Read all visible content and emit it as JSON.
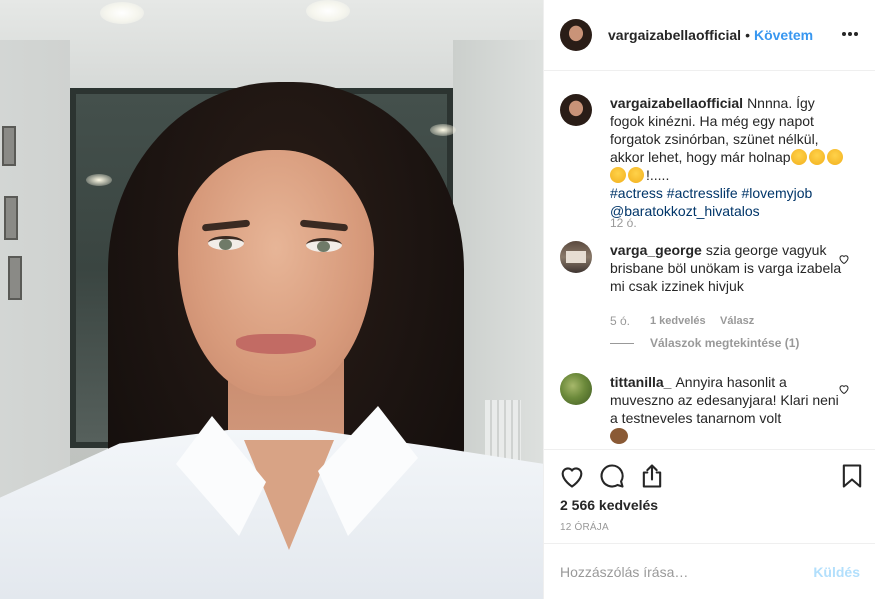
{
  "post": {
    "username": "vargaizabellaofficial",
    "separator": "•",
    "follow_label": "Követem",
    "caption": {
      "username": "vargaizabellaofficial",
      "text": "Nnnna. Így fogok kinézni. Ha még egy napot forgatok zsinórban, szünet nélkül, akkor lehet, hogy már holnap",
      "trail": "!.....",
      "hashtags": "#actress #actresslife #lovemyjob",
      "mention": "@baratokkozt_hivatalos",
      "time": "12 ó."
    },
    "comments": [
      {
        "username": "varga_george",
        "text": "szia george vagyuk brisbane böl unökam is varga izabela mi csak izzinek hivjuk",
        "time": "5 ó.",
        "likes": "1 kedvelés",
        "reply_label": "Válasz",
        "view_replies": "Válaszok megtekintése (1)"
      },
      {
        "username": "tittanilla_",
        "text": "Annyira hasonlit a muveszno az edesanyjara! Klari neni a testneveles tanarnom volt"
      }
    ],
    "likes_count": "2 566 kedvelés",
    "age": "12 ÓRÁJA",
    "comment_placeholder": "Hozzászólás írása…",
    "post_button": "Küldés"
  },
  "icons": {
    "like": "heart-icon",
    "comment": "comment-bubble-icon",
    "share": "share-icon",
    "save": "bookmark-icon",
    "more": "more-options-icon"
  },
  "colors": {
    "link": "#3897f0",
    "hashtag": "#003569",
    "muted": "#999999",
    "post_disabled": "#b2dffc"
  }
}
